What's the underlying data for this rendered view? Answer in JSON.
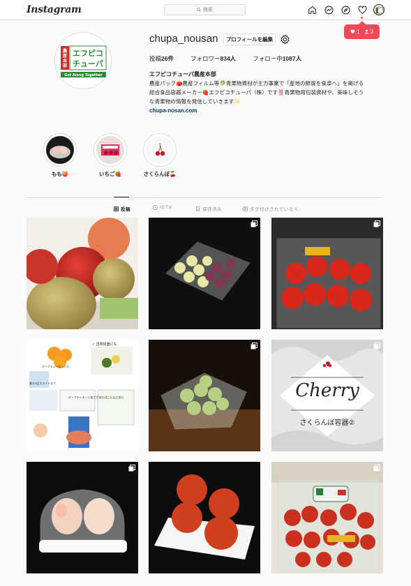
{
  "nav": {
    "logo": "Instagram",
    "search_placeholder": "検索",
    "notifications": {
      "likes": "1",
      "follows": "3"
    }
  },
  "profile": {
    "username": "chupa_nousan",
    "edit_button": "プロフィールを編集",
    "stats": {
      "posts_label": "投稿",
      "posts": "26件",
      "followers_label": "フォロワー",
      "followers": "834人",
      "following_label": "フォロー中",
      "following": "1087人"
    },
    "display_name": "エフピコチューパ農産本部",
    "bio_line1": "農産パック🍅農産フィルム等🥬青果物資材が主力事業で「産地の鮮度を食卓へ」を掲げる",
    "bio_line2": "総合食品容器メーカー🍓エフピコチューパ（株）です‼️青果物用包装資材や、美味しそう",
    "bio_line3": "な青果物の情報を発信していきます✨",
    "website": "chupa-nosan.com",
    "logo_text_top": "エフピコ",
    "logo_text_bottom": "チューパ",
    "logo_side": "農産本部",
    "logo_tagline": "Get Along Together"
  },
  "highlights": [
    {
      "label": "もも🍑"
    },
    {
      "label": "いちご🍓"
    },
    {
      "label": "さくらんぼ🍒"
    }
  ],
  "tabs": [
    {
      "label": "投稿",
      "icon": "grid-icon"
    },
    {
      "label": "IGTV",
      "icon": "igtv-icon"
    },
    {
      "label": "保存済み",
      "icon": "bookmark-icon"
    },
    {
      "label": "タグ付けされている人",
      "icon": "tagged-icon"
    }
  ],
  "posts": {
    "cherry_title": "Cherry",
    "cherry_subtitle": "さくらんぼ容器②",
    "infographic_label1": "✓ 透明容器にも",
    "infographic_label2": "セーフティーエッジも",
    "infographic_label3": "最大5回スライドまで",
    "infographic_label4": "セーフティエッジ加工があればこんなに安心"
  },
  "colors": {
    "accent": "#ed4956",
    "link": "#00376b",
    "border": "#dbdbdb",
    "logo_green": "#2e8b3a",
    "logo_red": "#c8332b"
  }
}
